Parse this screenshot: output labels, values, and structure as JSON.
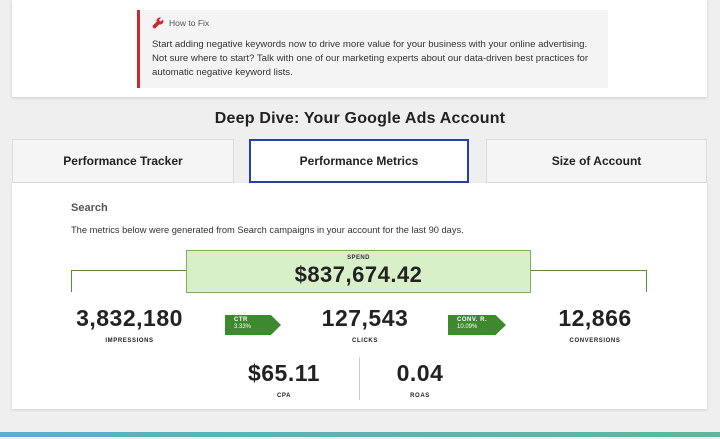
{
  "how_to_fix": {
    "label": "How to Fix",
    "text": "Start adding negative keywords now to drive more value for your business with your online advertising. Not sure where to start? Talk with one of our marketing experts about our data-driven best practices for automatic negative keyword lists.",
    "icon": "wrench-icon",
    "accent": "#c62b2f"
  },
  "section_title": "Deep Dive: Your Google Ads Account",
  "tabs": [
    {
      "label": "Performance Tracker",
      "active": false
    },
    {
      "label": "Performance Metrics",
      "active": true
    },
    {
      "label": "Size of Account",
      "active": false
    }
  ],
  "search": {
    "title": "Search",
    "description": "The metrics below were generated from Search campaigns in your account for the last 90 days."
  },
  "spend": {
    "label": "SPEND",
    "value": "$837,674.42"
  },
  "metrics": {
    "impressions": {
      "value": "3,832,180",
      "label": "IMPRESSIONS"
    },
    "clicks": {
      "value": "127,543",
      "label": "CLICKS"
    },
    "conversions": {
      "value": "12,866",
      "label": "CONVERSIONS"
    },
    "cpa": {
      "value": "$65.11",
      "label": "CPA"
    },
    "roas": {
      "value": "0.04",
      "label": "ROAS"
    }
  },
  "rates": {
    "ctr": {
      "label": "CTR",
      "value": "3.33%"
    },
    "conv": {
      "label": "CONV. R.",
      "value": "10.09%"
    }
  },
  "colors": {
    "active_tab_border": "#2540a8",
    "green": "#3d8a2e",
    "spend_bg": "#d8f0c8"
  }
}
